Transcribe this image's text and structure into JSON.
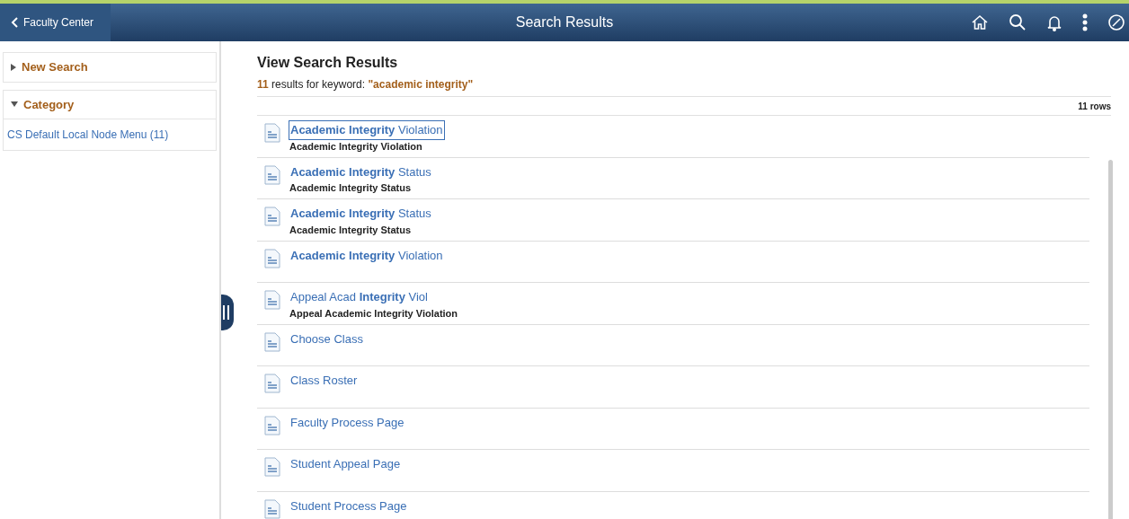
{
  "header": {
    "back_label": "Faculty Center",
    "title": "Search Results"
  },
  "sidebar": {
    "sections": [
      {
        "label": "New Search",
        "expanded": false
      },
      {
        "label": "Category",
        "expanded": true,
        "items": [
          "CS Default Local Node Menu (11)"
        ]
      }
    ]
  },
  "results": {
    "heading": "View Search Results",
    "count": "11",
    "summary_text": "results for keyword:",
    "keyword": "\"academic integrity\"",
    "rows_label": "11 rows",
    "rows": [
      {
        "title": "**Academic Integrity** Violation",
        "subtitle": "Academic Integrity Violation",
        "focused": true
      },
      {
        "title": "**Academic Integrity** Status",
        "subtitle": "Academic Integrity Status",
        "focused": false
      },
      {
        "title": "**Academic Integrity** Status",
        "subtitle": "Academic Integrity Status",
        "focused": false
      },
      {
        "title": "**Academic Integrity** Violation",
        "focused": false
      },
      {
        "title": "Appeal Acad **Integrity** Viol",
        "subtitle": "Appeal Academic Integrity Violation",
        "focused": false
      },
      {
        "title": "Choose Class",
        "focused": false
      },
      {
        "title": "Class Roster",
        "focused": false
      },
      {
        "title": "Faculty Process Page",
        "focused": false
      },
      {
        "title": "Student Appeal Page",
        "focused": false
      },
      {
        "title": "Student Process Page",
        "focused": false
      }
    ]
  }
}
